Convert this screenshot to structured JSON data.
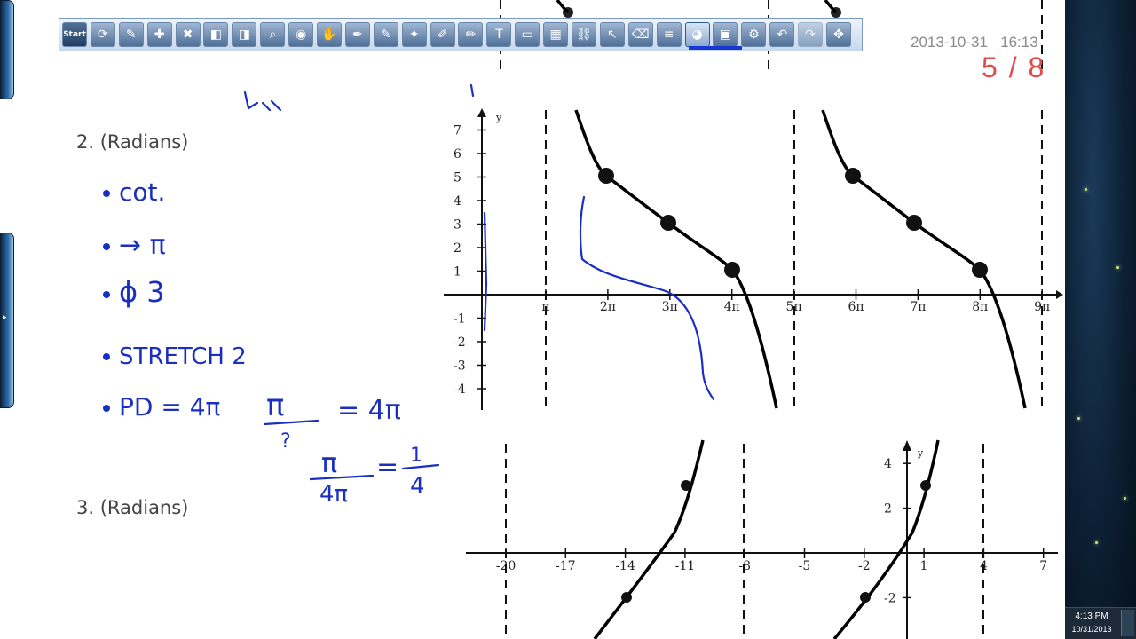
{
  "toolbar": {
    "buttons": [
      {
        "name": "start-button",
        "glyph": "Start"
      },
      {
        "name": "refresh-icon",
        "glyph": "⟳"
      },
      {
        "name": "new-page-icon",
        "glyph": "✎"
      },
      {
        "name": "add-page-icon",
        "glyph": "✚"
      },
      {
        "name": "delete-page-icon",
        "glyph": "✖"
      },
      {
        "name": "previous-page-icon",
        "glyph": "◧"
      },
      {
        "name": "next-page-icon",
        "glyph": "◨"
      },
      {
        "name": "zoom-icon",
        "glyph": "⌕"
      },
      {
        "name": "spotlight-icon",
        "glyph": "◉"
      },
      {
        "name": "hand-icon",
        "glyph": "✋"
      },
      {
        "name": "pen-icon",
        "glyph": "✒"
      },
      {
        "name": "brush-icon",
        "glyph": "✎"
      },
      {
        "name": "magic-pen-icon",
        "glyph": "✦"
      },
      {
        "name": "highlighter-icon",
        "glyph": "✐"
      },
      {
        "name": "pencil-icon",
        "glyph": "✏"
      },
      {
        "name": "text-icon",
        "glyph": "T"
      },
      {
        "name": "ruler-icon",
        "glyph": "▭"
      },
      {
        "name": "shapes-icon",
        "glyph": "▦"
      },
      {
        "name": "link-icon",
        "glyph": "⛓"
      },
      {
        "name": "cursor-icon",
        "glyph": "↖"
      },
      {
        "name": "eraser-icon",
        "glyph": "⌫"
      },
      {
        "name": "line-width-icon",
        "glyph": "≡"
      },
      {
        "name": "color-palette-icon",
        "glyph": "◕"
      },
      {
        "name": "screen-capture-icon",
        "glyph": "▣"
      },
      {
        "name": "settings-icon",
        "glyph": "⚙"
      },
      {
        "name": "undo-icon",
        "glyph": "↶"
      },
      {
        "name": "redo-icon",
        "glyph": "↷"
      },
      {
        "name": "move-toolbar-icon",
        "glyph": "✥"
      }
    ],
    "active_index": 22,
    "pen_color": "#1636d8"
  },
  "stamp": {
    "date": "2013-10-31",
    "time": "16:13"
  },
  "pagination": {
    "current": "5",
    "separator": "/",
    "total": "8"
  },
  "problems": {
    "p2": "2.  (Radians)",
    "p3": "3.  (Radians)"
  },
  "handwriting": {
    "notes": [
      "cot.",
      "→ π",
      "ϕ 3",
      "STRETCH 2",
      "PD = 4π"
    ],
    "color": "#1a2fc0"
  },
  "graph1": {
    "y_ticks": [
      "7",
      "6",
      "5",
      "4",
      "3",
      "2",
      "1",
      "-1",
      "-2",
      "-3",
      "-4"
    ],
    "x_ticks": [
      "π",
      "2π",
      "3π",
      "4π",
      "5π",
      "6π",
      "7π",
      "8π",
      "9π"
    ],
    "y_label": "y"
  },
  "graph2": {
    "x_ticks": [
      "-20",
      "-17",
      "-14",
      "-11",
      "-8",
      "-5",
      "-2",
      "1",
      "4",
      "7"
    ],
    "y_ticks": [
      "4",
      "2",
      "-2"
    ],
    "y_label": "y"
  },
  "taskbar": {
    "time": "4:13 PM",
    "date": "10/31/2013"
  }
}
